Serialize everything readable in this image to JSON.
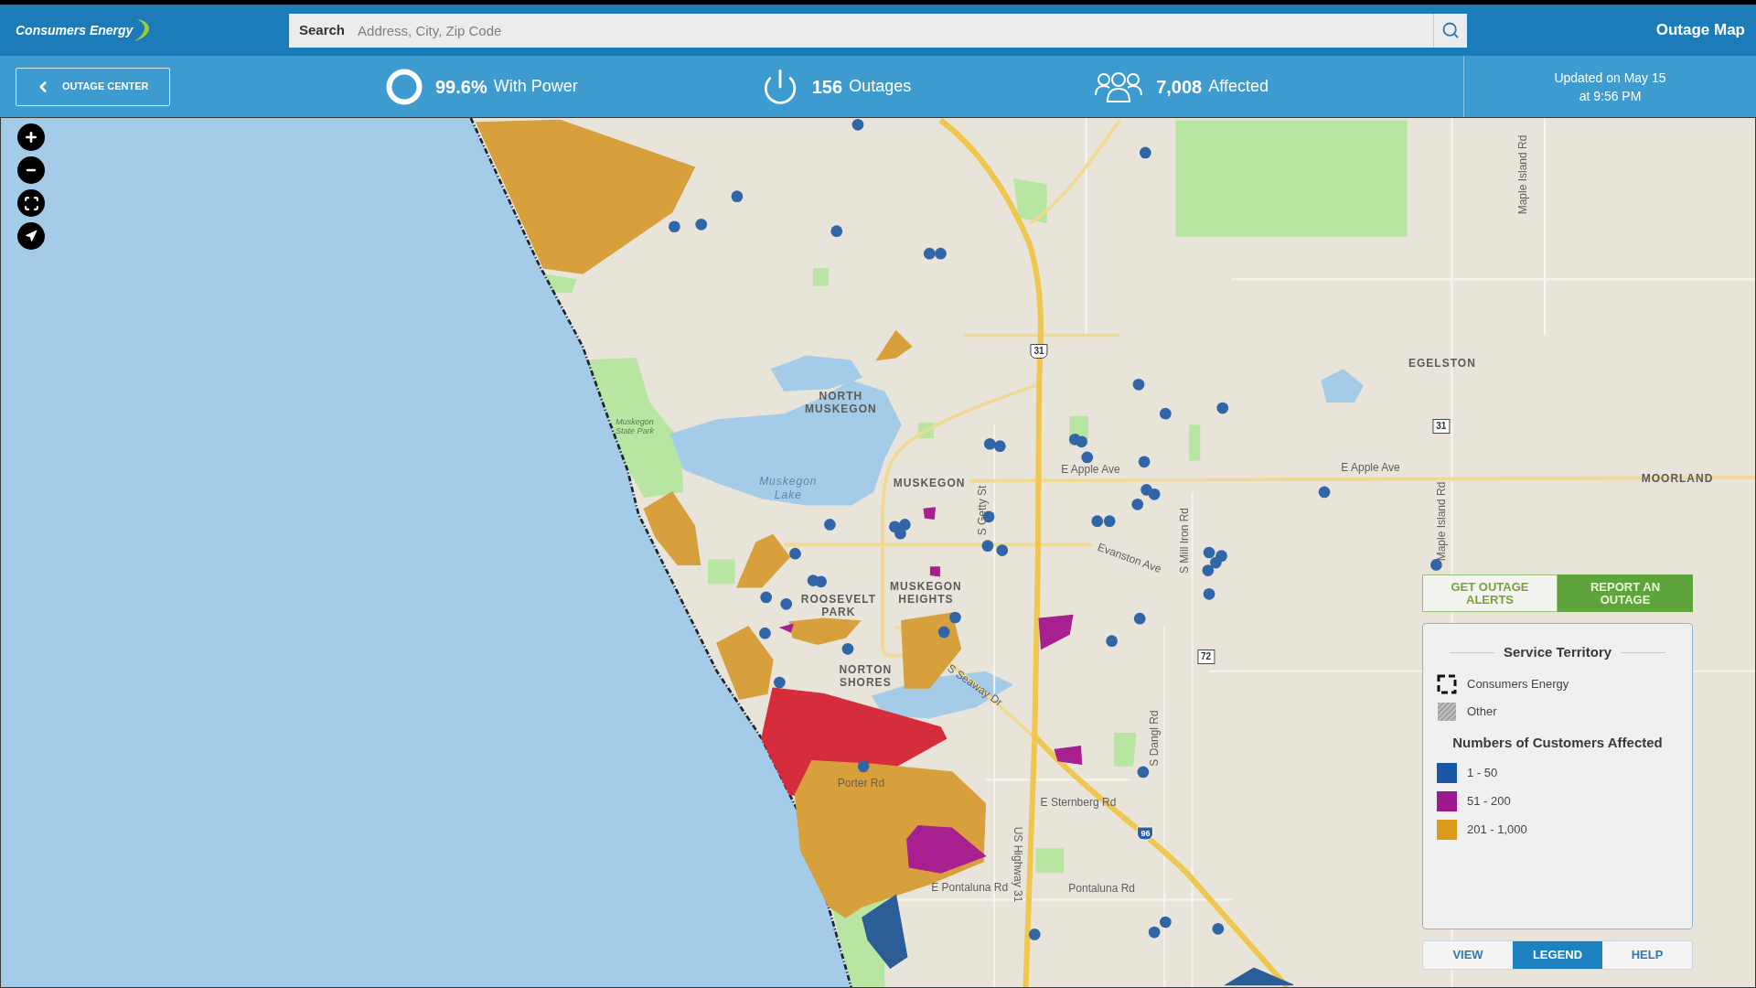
{
  "header": {
    "logo": "Consumers Energy",
    "search": {
      "label": "Search",
      "placeholder": "Address, City, Zip Code"
    },
    "title": "Outage Map"
  },
  "stats_bar": {
    "back_button": "OUTAGE CENTER",
    "stats": [
      {
        "kind": "with_power",
        "value": "99.6%",
        "label": "With Power"
      },
      {
        "kind": "outages",
        "value": "156",
        "label": "Outages"
      },
      {
        "kind": "affected",
        "value": "7,008",
        "label": "Affected"
      }
    ],
    "updated": [
      "Updated on May 15",
      "at 9:56 PM"
    ]
  },
  "map": {
    "labels": [
      {
        "kind": "place",
        "text": "NORTH MUSKEGON"
      },
      {
        "kind": "water",
        "text": "Muskegon Lake"
      },
      {
        "kind": "park",
        "text": "Muskegon State Park"
      },
      {
        "kind": "place",
        "text": "MUSKEGON"
      },
      {
        "kind": "road",
        "text": "E Apple Ave"
      },
      {
        "kind": "road",
        "text": "E Apple Ave"
      },
      {
        "kind": "place",
        "text": "MOORLAND"
      },
      {
        "kind": "place",
        "text": "EGELSTON"
      },
      {
        "kind": "road",
        "text": "S Getty St"
      },
      {
        "kind": "road",
        "text": "Evanston Ave"
      },
      {
        "kind": "road",
        "text": "S Mill Iron Rd"
      },
      {
        "kind": "road",
        "text": "Maple Island Rd"
      },
      {
        "kind": "road",
        "text": "Maple Island Rd"
      },
      {
        "kind": "place",
        "text": "MUSKEGON HEIGHTS"
      },
      {
        "kind": "place",
        "text": "ROOSEVELT PARK"
      },
      {
        "kind": "place",
        "text": "NORTON SHORES"
      },
      {
        "kind": "road",
        "text": "S Seaway Dr"
      },
      {
        "kind": "road",
        "text": "Porter Rd"
      },
      {
        "kind": "road",
        "text": "E Sternberg Rd"
      },
      {
        "kind": "road",
        "text": "US Highway 31"
      },
      {
        "kind": "road",
        "text": "E Pontaluna Rd"
      },
      {
        "kind": "road",
        "text": "Pontaluna Rd"
      },
      {
        "kind": "road",
        "text": "S Dangl Rd"
      },
      {
        "kind": "us_route",
        "text": "31"
      },
      {
        "kind": "state_route",
        "text": "31"
      },
      {
        "kind": "state_route",
        "text": "72"
      },
      {
        "kind": "interstate",
        "text": "96"
      }
    ]
  },
  "actions": [
    {
      "kind": "secondary",
      "label": "GET OUTAGE ALERTS"
    },
    {
      "kind": "primary",
      "label": "REPORT AN OUTAGE"
    }
  ],
  "legend": {
    "territory_title": "Service Territory",
    "territory": [
      {
        "kind": "outline",
        "label": "Consumers Energy"
      },
      {
        "kind": "hatched",
        "label": "Other"
      }
    ],
    "customers_title": "Numbers of Customers Affected",
    "ranges": [
      {
        "label": "1 - 50",
        "color": "#1a56a6"
      },
      {
        "label": "51 - 200",
        "color": "#9b1b8e"
      },
      {
        "label": "201 - 1,000",
        "color": "#dc9a1c"
      }
    ]
  },
  "panel_tabs": [
    {
      "label": "VIEW",
      "selected": false
    },
    {
      "label": "LEGEND",
      "selected": true
    },
    {
      "label": "HELP",
      "selected": false
    }
  ]
}
